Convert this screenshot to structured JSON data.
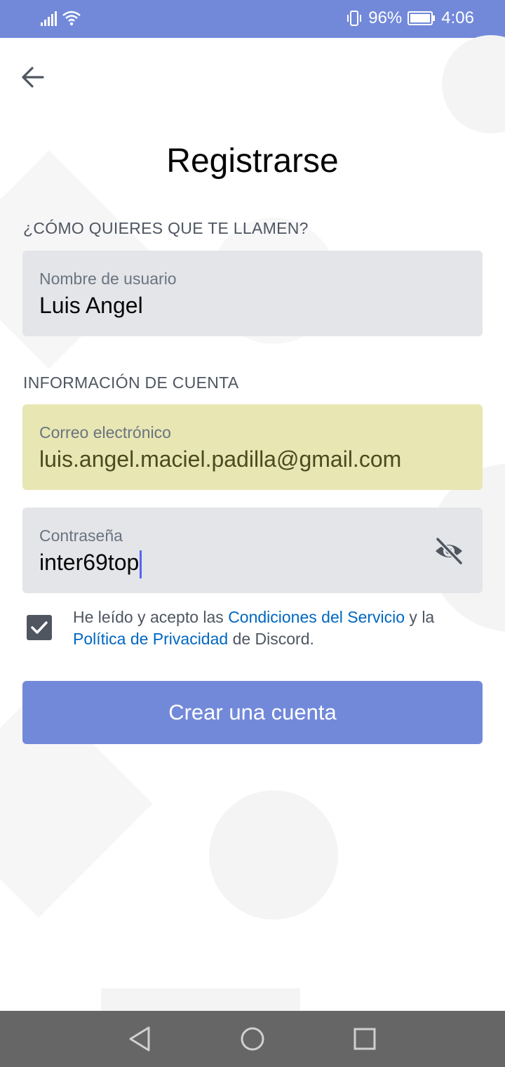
{
  "status_bar": {
    "battery": "96%",
    "time": "4:06"
  },
  "page": {
    "title": "Registrarse"
  },
  "sections": {
    "username_heading": "¿CÓMO QUIERES QUE TE LLAMEN?",
    "account_heading": "INFORMACIÓN DE CUENTA"
  },
  "fields": {
    "username": {
      "label": "Nombre de usuario",
      "value": "Luis Angel"
    },
    "email": {
      "label": "Correo electrónico",
      "value": "luis.angel.maciel.padilla@gmail.com"
    },
    "password": {
      "label": "Contraseña",
      "value": "inter69top"
    }
  },
  "terms": {
    "checked": true,
    "prefix": "He leído y acepto las ",
    "tos_link": "Condiciones del Servicio",
    "middle": " y la ",
    "privacy_link": "Política de Privacidad",
    "suffix": " de Discord."
  },
  "actions": {
    "create_account": "Crear una cuenta"
  },
  "icons": {
    "back": "arrow-left-icon",
    "password_visibility": "eye-off-icon",
    "nav_back": "triangle-back-icon",
    "nav_home": "circle-home-icon",
    "nav_recents": "square-recents-icon"
  },
  "colors": {
    "brand": "#7289da",
    "link": "#0067c0",
    "autofill": "#e8e6b3",
    "field_bg": "#e3e5e8"
  }
}
